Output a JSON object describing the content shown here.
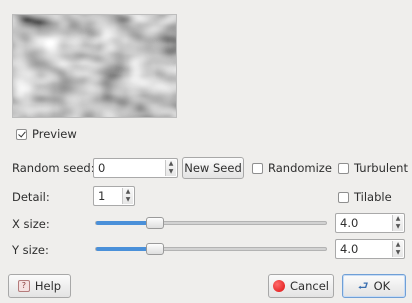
{
  "preview": {
    "checkbox_label": "Preview",
    "checked": true
  },
  "random_seed": {
    "label": "Random seed:",
    "value": "0",
    "new_seed_label": "New Seed",
    "randomize_label": "Randomize",
    "randomize_checked": false
  },
  "turbulent": {
    "label": "Turbulent",
    "checked": false
  },
  "detail": {
    "label": "Detail:",
    "value": "1"
  },
  "tilable": {
    "label": "Tilable",
    "checked": false
  },
  "x_size": {
    "label": "X size:",
    "value": "4.0",
    "fraction": 0.26
  },
  "y_size": {
    "label": "Y size:",
    "value": "4.0",
    "fraction": 0.26
  },
  "buttons": {
    "help": "Help",
    "cancel": "Cancel",
    "ok": "OK"
  },
  "icons": {
    "help": "help-icon",
    "cancel": "cancel-icon",
    "ok": "ok-icon",
    "spin_up": "▲",
    "spin_down": "▼"
  },
  "colors": {
    "slider_fill": "#4a90d9",
    "dialog_bg": "#efeeec"
  }
}
